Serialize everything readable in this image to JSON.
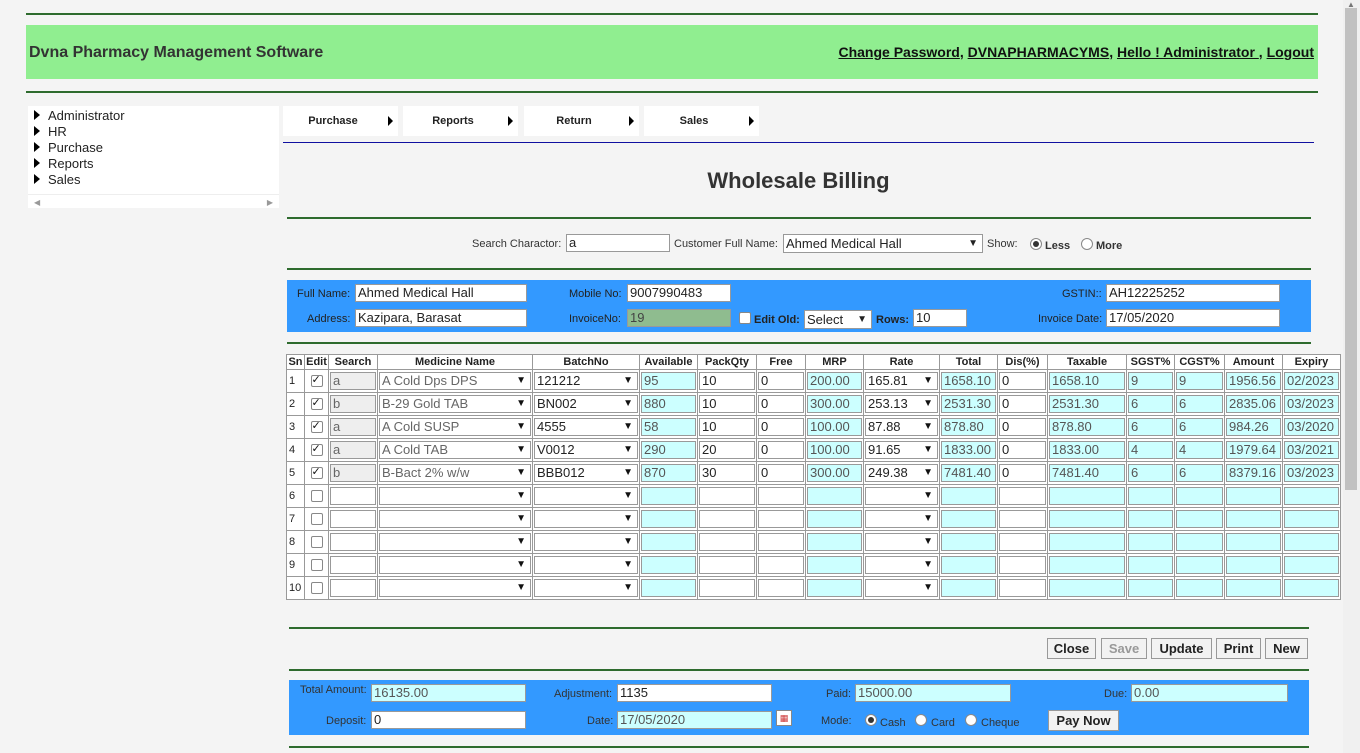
{
  "header": {
    "title": "Dvna Pharmacy Management Software",
    "links": {
      "change_password": "Change Password",
      "sep1": ", ",
      "user": "DVNAPHARMACYMS",
      "sep2": ", ",
      "hello": "Hello ! Administrator ",
      "sep3": ", ",
      "logout": "Logout"
    }
  },
  "sidebar": {
    "items": [
      "Administrator",
      "HR",
      "Purchase",
      "Reports",
      "Sales"
    ]
  },
  "topnav": {
    "items": [
      "Purchase",
      "Reports",
      "Return",
      "Sales"
    ]
  },
  "page_title": "Wholesale Billing",
  "search": {
    "char_label": "Search Charactor:",
    "char_value": "a",
    "customer_label": "Customer Full Name:",
    "customer_value": "Ahmed Medical Hall",
    "show_label": "Show:",
    "less": "Less",
    "more": "More",
    "show_selected": "Less"
  },
  "customer": {
    "full_name_label": "Full Name:",
    "full_name": "Ahmed Medical Hall",
    "mobile_label": "Mobile No:",
    "mobile": "9007990483",
    "gstin_label": "GSTIN::",
    "gstin": "AH12225252",
    "address_label": "Address:",
    "address": "Kazipara, Barasat",
    "invoice_label": "InvoiceNo:",
    "invoice": "19",
    "edit_old_label": "Edit Old:",
    "edit_old_value": "Select",
    "rows_label": "Rows:",
    "rows": "10",
    "invoice_date_label": "Invoice Date:",
    "invoice_date": "17/05/2020"
  },
  "grid": {
    "headers": [
      "Sn",
      "Edit",
      "Search",
      "Medicine Name",
      "BatchNo",
      "Available",
      "PackQty",
      "Free",
      "MRP",
      "Rate",
      "Total",
      "Dis(%)",
      "Taxable",
      "SGST%",
      "CGST%",
      "Amount",
      "Expiry"
    ],
    "rows": [
      {
        "sn": "1",
        "edit": true,
        "search": "a",
        "medicine": "A Cold Dps DPS",
        "batch": "121212",
        "available": "95",
        "packqty": "10",
        "free": "0",
        "mrp": "200.00",
        "rate": "165.81",
        "total": "1658.10",
        "dis": "0",
        "taxable": "1658.10",
        "sgst": "9",
        "cgst": "9",
        "amount": "1956.56",
        "expiry": "02/2023"
      },
      {
        "sn": "2",
        "edit": true,
        "search": "b",
        "medicine": "B-29 Gold TAB",
        "batch": "BN002",
        "available": "880",
        "packqty": "10",
        "free": "0",
        "mrp": "300.00",
        "rate": "253.13",
        "total": "2531.30",
        "dis": "0",
        "taxable": "2531.30",
        "sgst": "6",
        "cgst": "6",
        "amount": "2835.06",
        "expiry": "03/2023"
      },
      {
        "sn": "3",
        "edit": true,
        "search": "a",
        "medicine": "A Cold SUSP",
        "batch": "4555",
        "available": "58",
        "packqty": "10",
        "free": "0",
        "mrp": "100.00",
        "rate": "87.88",
        "total": "878.80",
        "dis": "0",
        "taxable": "878.80",
        "sgst": "6",
        "cgst": "6",
        "amount": "984.26",
        "expiry": "03/2020"
      },
      {
        "sn": "4",
        "edit": true,
        "search": "a",
        "medicine": "A Cold TAB",
        "batch": "V0012",
        "available": "290",
        "packqty": "20",
        "free": "0",
        "mrp": "100.00",
        "rate": "91.65",
        "total": "1833.00",
        "dis": "0",
        "taxable": "1833.00",
        "sgst": "4",
        "cgst": "4",
        "amount": "1979.64",
        "expiry": "03/2021"
      },
      {
        "sn": "5",
        "edit": true,
        "search": "b",
        "medicine": "B-Bact 2% w/w",
        "batch": "BBB012",
        "available": "870",
        "packqty": "30",
        "free": "0",
        "mrp": "300.00",
        "rate": "249.38",
        "total": "7481.40",
        "dis": "0",
        "taxable": "7481.40",
        "sgst": "6",
        "cgst": "6",
        "amount": "8379.16",
        "expiry": "03/2023"
      },
      {
        "sn": "6",
        "edit": false,
        "search": "",
        "medicine": "",
        "batch": "",
        "available": "",
        "packqty": "",
        "free": "",
        "mrp": "",
        "rate": "",
        "total": "",
        "dis": "",
        "taxable": "",
        "sgst": "",
        "cgst": "",
        "amount": "",
        "expiry": ""
      },
      {
        "sn": "7",
        "edit": false,
        "search": "",
        "medicine": "",
        "batch": "",
        "available": "",
        "packqty": "",
        "free": "",
        "mrp": "",
        "rate": "",
        "total": "",
        "dis": "",
        "taxable": "",
        "sgst": "",
        "cgst": "",
        "amount": "",
        "expiry": ""
      },
      {
        "sn": "8",
        "edit": false,
        "search": "",
        "medicine": "",
        "batch": "",
        "available": "",
        "packqty": "",
        "free": "",
        "mrp": "",
        "rate": "",
        "total": "",
        "dis": "",
        "taxable": "",
        "sgst": "",
        "cgst": "",
        "amount": "",
        "expiry": ""
      },
      {
        "sn": "9",
        "edit": false,
        "search": "",
        "medicine": "",
        "batch": "",
        "available": "",
        "packqty": "",
        "free": "",
        "mrp": "",
        "rate": "",
        "total": "",
        "dis": "",
        "taxable": "",
        "sgst": "",
        "cgst": "",
        "amount": "",
        "expiry": ""
      },
      {
        "sn": "10",
        "edit": false,
        "search": "",
        "medicine": "",
        "batch": "",
        "available": "",
        "packqty": "",
        "free": "",
        "mrp": "",
        "rate": "",
        "total": "",
        "dis": "",
        "taxable": "",
        "sgst": "",
        "cgst": "",
        "amount": "",
        "expiry": ""
      }
    ]
  },
  "actions": {
    "close": "Close",
    "save": "Save",
    "update": "Update",
    "print": "Print",
    "new": "New"
  },
  "payment": {
    "total_label": "Total Amount:",
    "total": "16135.00",
    "adjustment_label": "Adjustment:",
    "adjustment": "1135",
    "paid_label": "Paid:",
    "paid": "15000.00",
    "due_label": "Due:",
    "due": "0.00",
    "deposit_label": "Deposit:",
    "deposit": "0",
    "date_label": "Date:",
    "date": "17/05/2020",
    "mode_label": "Mode:",
    "cash": "Cash",
    "card": "Card",
    "cheque": "Cheque",
    "mode_selected": "Cash",
    "pay_now": "Pay Now"
  },
  "colors": {
    "header_bg": "#90ee90",
    "panel_bg": "#3399ff",
    "readonly_bg": "#ccffff",
    "rule": "#2e6b2e"
  }
}
